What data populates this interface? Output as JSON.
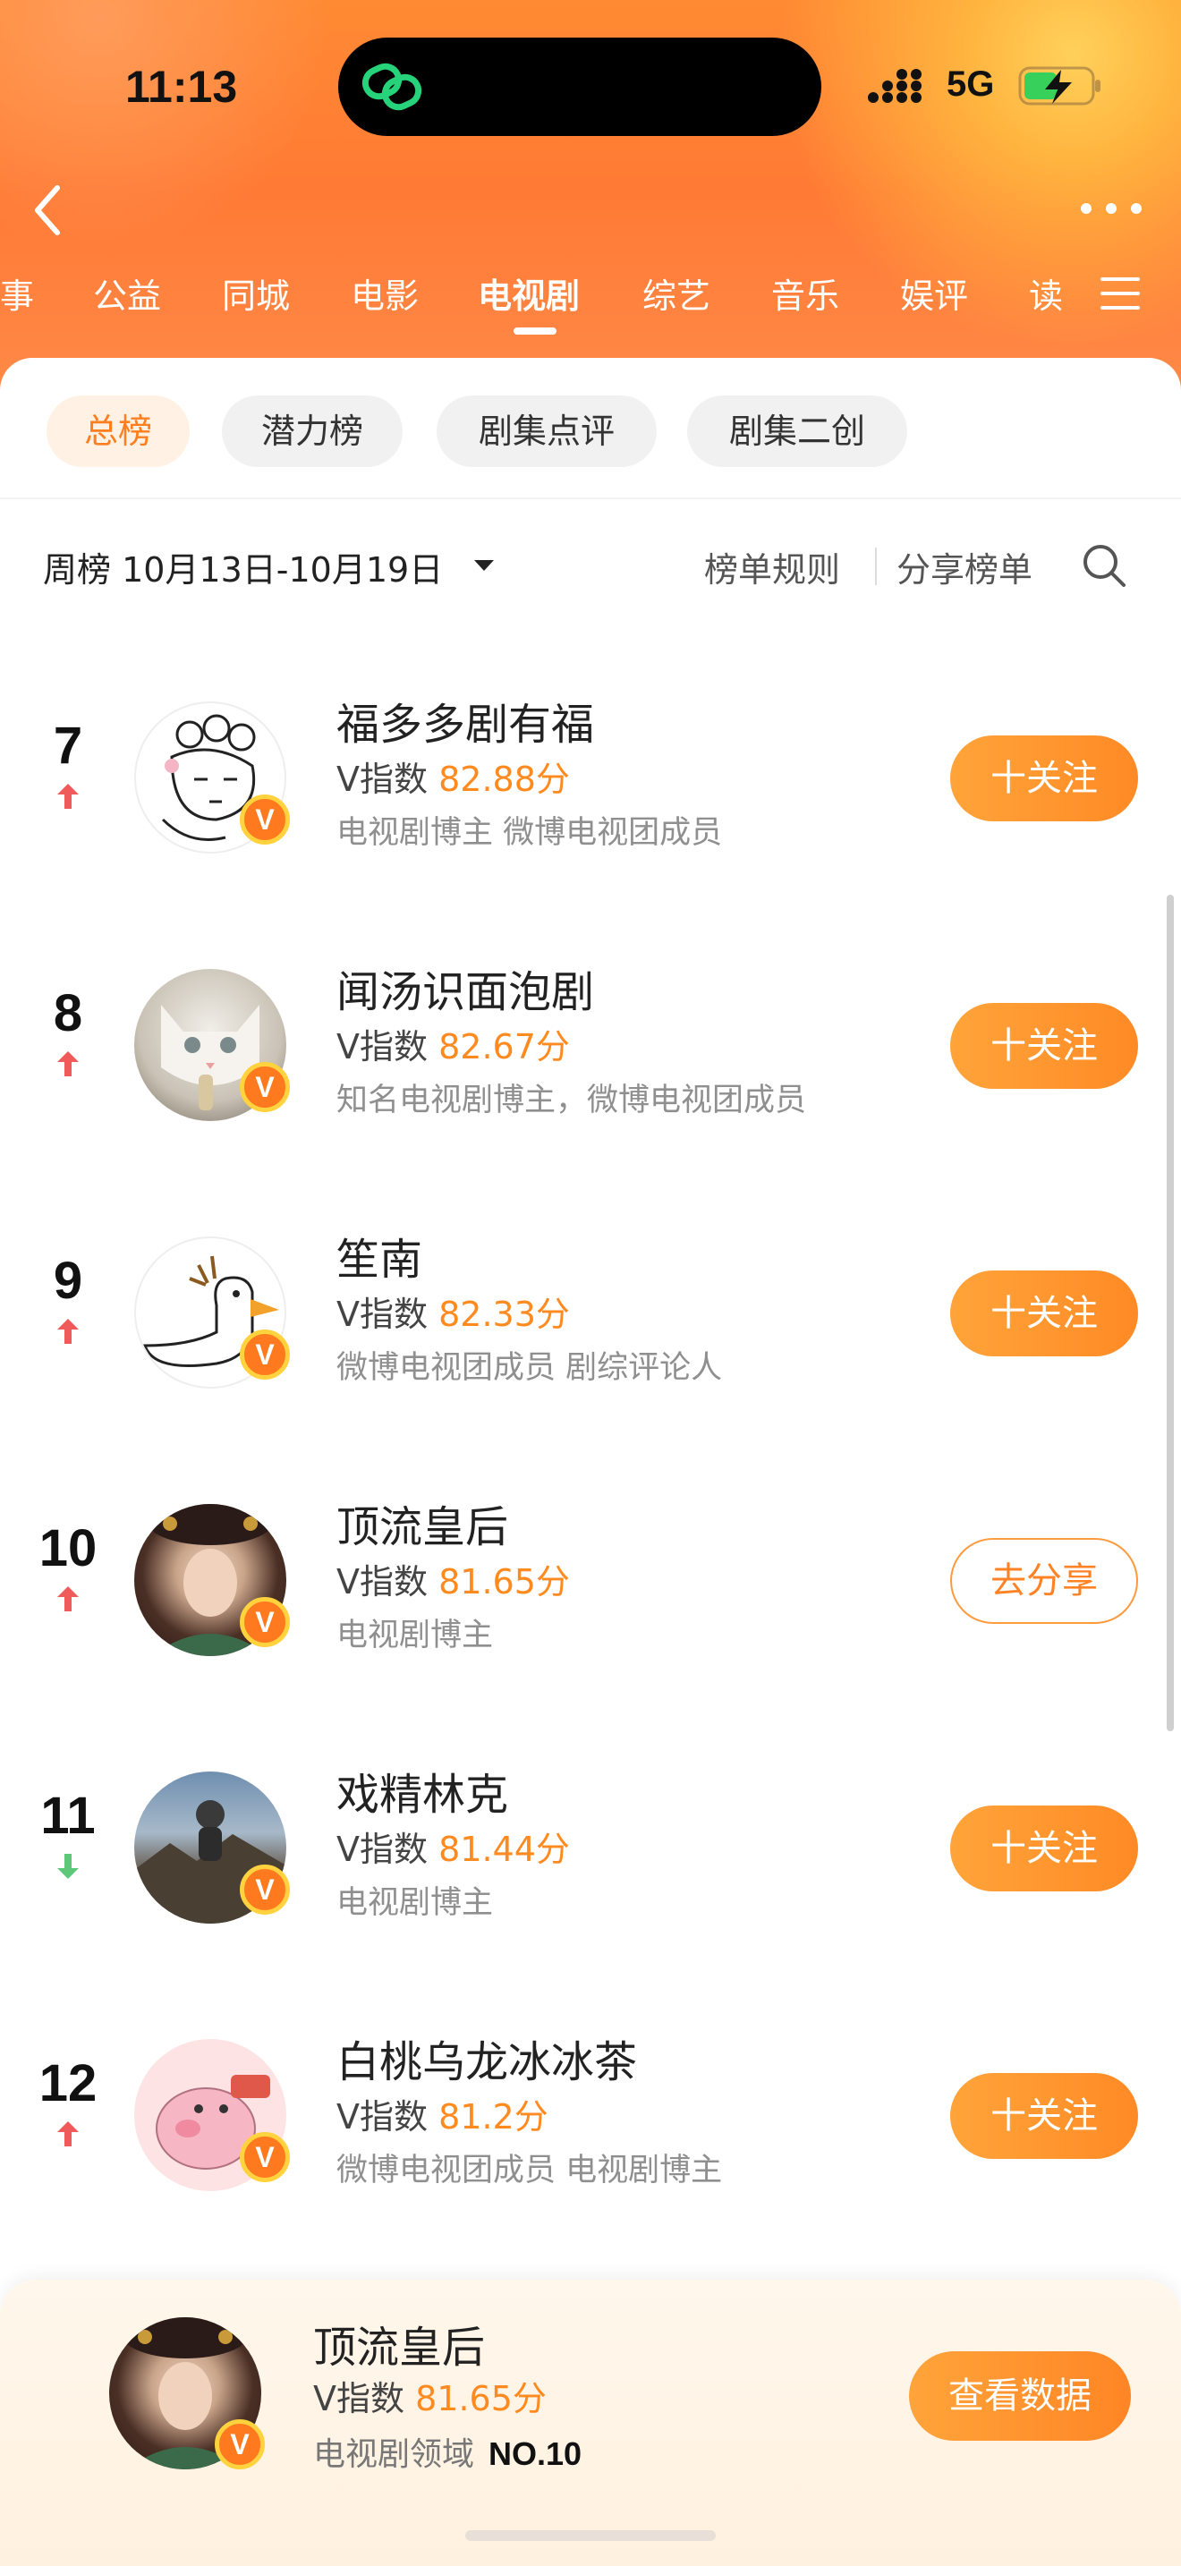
{
  "status_bar": {
    "time": "11:13",
    "network": "5G"
  },
  "nav": {
    "tabs": [
      {
        "label": "事"
      },
      {
        "label": "公益"
      },
      {
        "label": "同城"
      },
      {
        "label": "电影"
      },
      {
        "label": "电视剧",
        "active": true
      },
      {
        "label": "综艺"
      },
      {
        "label": "音乐"
      },
      {
        "label": "娱评"
      },
      {
        "label": "读"
      }
    ]
  },
  "chips": [
    {
      "label": "总榜",
      "active": true
    },
    {
      "label": "潜力榜"
    },
    {
      "label": "剧集点评"
    },
    {
      "label": "剧集二创"
    }
  ],
  "header": {
    "period": "周榜 10月13日-10月19日",
    "rules_label": "榜单规则",
    "share_label": "分享榜单"
  },
  "rows": [
    {
      "rank": "7",
      "trend": "up",
      "name": "福多多剧有福",
      "v_label": "V指数",
      "score": "82.88分",
      "desc": "电视剧博主 微博电视团成员",
      "action": "十关注"
    },
    {
      "rank": "8",
      "trend": "up",
      "name": "闻汤识面泡剧",
      "v_label": "V指数",
      "score": "82.67分",
      "desc": "知名电视剧博主，微博电视团成员",
      "action": "十关注"
    },
    {
      "rank": "9",
      "trend": "up",
      "name": "笙南",
      "v_label": "V指数",
      "score": "82.33分",
      "desc": "微博电视团成员 剧综评论人",
      "action": "十关注"
    },
    {
      "rank": "10",
      "trend": "up",
      "name": "顶流皇后",
      "v_label": "V指数",
      "score": "81.65分",
      "desc": "电视剧博主",
      "action": "去分享"
    },
    {
      "rank": "11",
      "trend": "down",
      "name": "戏精林克",
      "v_label": "V指数",
      "score": "81.44分",
      "desc": "电视剧博主",
      "action": "十关注"
    },
    {
      "rank": "12",
      "trend": "up",
      "name": "白桃乌龙冰冰茶",
      "v_label": "V指数",
      "score": "81.2分",
      "desc": "微博电视团成员 电视剧博主",
      "action": "十关注"
    }
  ],
  "badge_letter": "V",
  "me": {
    "name": "顶流皇后",
    "v_label": "V指数",
    "score": "81.65分",
    "domain": "电视剧领域",
    "rank_no": "NO.10",
    "button": "查看数据"
  },
  "colors": {
    "accent": "#ff8a25",
    "trend_up": "#f15a5a",
    "trend_down": "#5dc87a"
  }
}
